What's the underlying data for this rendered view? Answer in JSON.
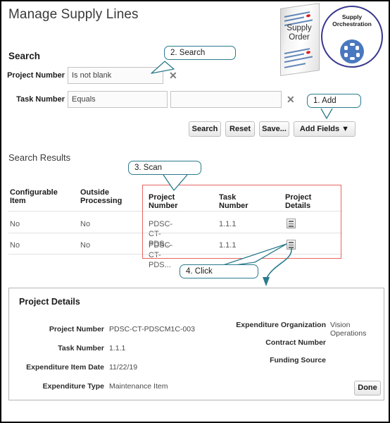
{
  "page": {
    "title": "Manage Supply Lines"
  },
  "logos": {
    "supply_order": "Supply\nOrder",
    "supply_order_line1": "Supply",
    "supply_order_line2": "Order",
    "orchestration_line1": "Supply",
    "orchestration_line2": "Orchestration",
    "accent_blue": "#4a78c0",
    "ring_purple": "#37378f"
  },
  "search": {
    "heading": "Search",
    "fields": [
      {
        "label": "Project Number",
        "operator": "Is not blank",
        "value": "",
        "has_value_field": false,
        "clear": "✕"
      },
      {
        "label": "Task Number",
        "operator": "Equals",
        "value": "",
        "has_value_field": true,
        "clear": "✕"
      }
    ],
    "buttons": [
      {
        "label": "Search"
      },
      {
        "label": "Reset"
      },
      {
        "label": "Save..."
      },
      {
        "label": "Add Fields ▼"
      }
    ]
  },
  "results": {
    "heading": "Search Results",
    "columns": [
      "Configurable Item",
      "Outside Processing",
      "Project Number",
      "Task Number",
      "Project Details"
    ],
    "columns_wrapped": [
      {
        "line1": "Configurable",
        "line2": "Item"
      },
      {
        "line1": "Outside",
        "line2": "Processing"
      },
      {
        "line1": "Project Number",
        "line2": ""
      },
      {
        "line1": "Task Number",
        "line2": ""
      },
      {
        "line1": "Project Details",
        "line2": ""
      }
    ],
    "rows": [
      {
        "configurable_item": "No",
        "outside_processing": "No",
        "project_number": "PDSC-CT-PDS...",
        "task_number": "1.1.1",
        "project_details_icon": "list-icon"
      },
      {
        "configurable_item": "No",
        "outside_processing": "No",
        "project_number": "PDSC-CT-PDS...",
        "task_number": "1.1.1",
        "project_details_icon": "list-icon"
      }
    ],
    "highlight_color": "#e8655f"
  },
  "callouts": [
    {
      "id": "add",
      "label": "1. Add"
    },
    {
      "id": "search",
      "label": "2. Search"
    },
    {
      "id": "scan",
      "label": "3. Scan"
    },
    {
      "id": "click",
      "label": "4. Click"
    }
  ],
  "callout_color": "#2a7b8c",
  "project_details": {
    "title": "Project Details",
    "left_fields": [
      {
        "label": "Project Number",
        "value": "PDSC-CT-PDSCM1C-003"
      },
      {
        "label": "Task Number",
        "value": "1.1.1"
      },
      {
        "label": "Expenditure Item Date",
        "value": "11/22/19"
      },
      {
        "label": "Expenditure Type",
        "value": "Maintenance Item"
      }
    ],
    "right_fields": [
      {
        "label": "Expenditure Organization",
        "value": "Vision Operations"
      },
      {
        "label": "Contract Number",
        "value": ""
      },
      {
        "label": "Funding Source",
        "value": ""
      }
    ],
    "done_button": "Done"
  }
}
